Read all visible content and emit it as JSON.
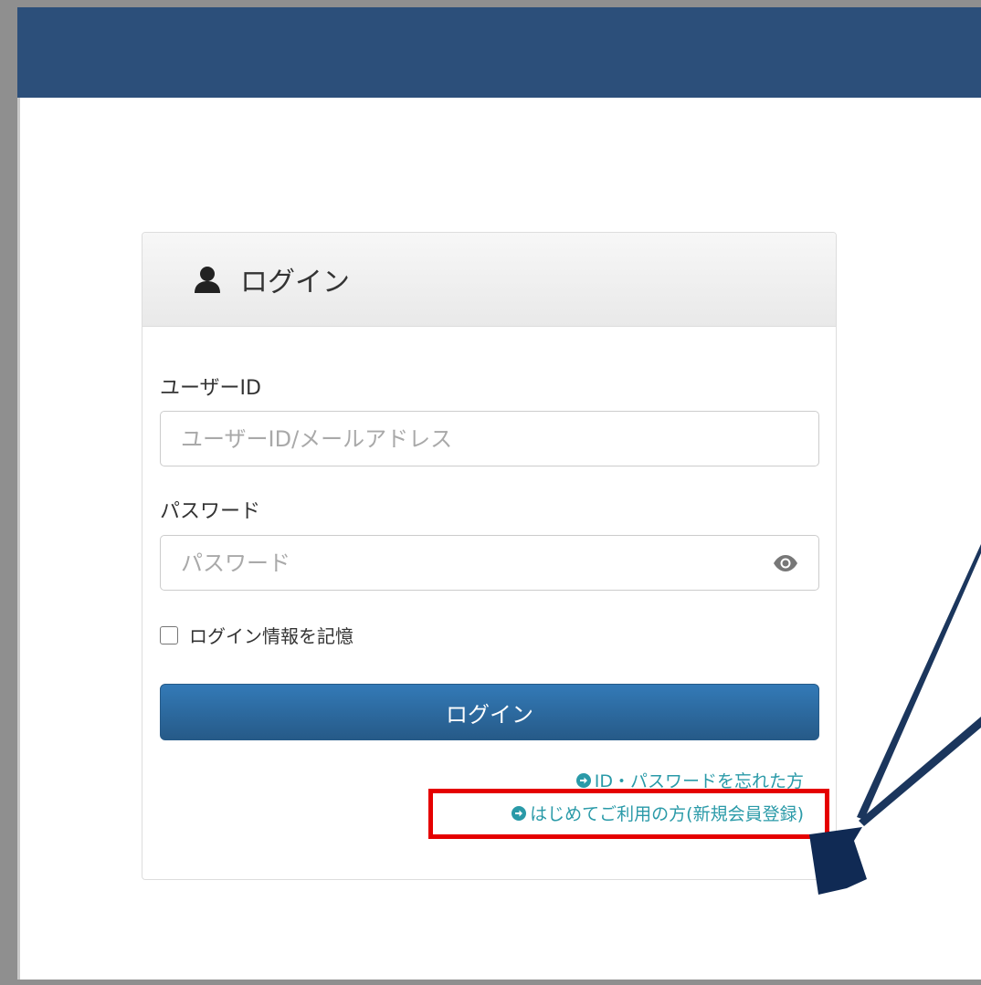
{
  "colors": {
    "navbar": "#2c4f7a",
    "primary_button": "#337ab7",
    "link": "#2a9aa8",
    "highlight": "#e50000",
    "pointer_arrow": "#102a54"
  },
  "login_panel": {
    "title": "ログイン",
    "title_icon": "user-icon",
    "user_id": {
      "label": "ユーザーID",
      "placeholder": "ユーザーID/メールアドレス",
      "value": ""
    },
    "password": {
      "label": "パスワード",
      "placeholder": "パスワード",
      "value": "",
      "toggle_icon": "eye-icon"
    },
    "remember": {
      "label": "ログイン情報を記憶",
      "checked": false
    },
    "submit_label": "ログイン",
    "links": [
      {
        "label": "ID・パスワードを忘れた方",
        "icon": "arrow-circle-right-icon"
      },
      {
        "label": "はじめてご利用の方(新規会員登録)",
        "icon": "arrow-circle-right-icon"
      }
    ]
  },
  "annotation": {
    "highlighted_link": "はじめてご利用の方(新規会員登録)"
  }
}
